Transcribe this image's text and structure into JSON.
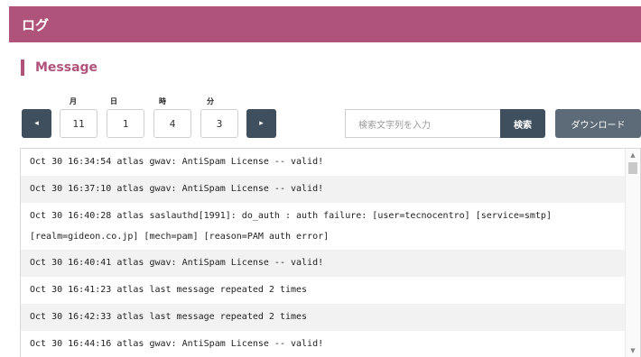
{
  "header": {
    "title": "ログ"
  },
  "section": {
    "title": "Message"
  },
  "date_labels": {
    "month": "月",
    "day": "日",
    "hour": "時",
    "minute": "分"
  },
  "date_values": {
    "month": "11",
    "day": "1",
    "hour": "4",
    "minute": "3"
  },
  "nav": {
    "prev_icon": "chevron-left-icon",
    "next_icon": "chevron-right-icon",
    "prev_glyph": "◂",
    "next_glyph": "▸"
  },
  "search": {
    "placeholder": "検索文字列を入力",
    "button_label": "検索"
  },
  "download": {
    "label": "ダウンロード"
  },
  "log_lines": [
    "Oct 30 16:34:54 atlas gwav: AntiSpam License -- valid!",
    "Oct 30 16:37:10 atlas gwav: AntiSpam License -- valid!",
    "Oct 30 16:40:28 atlas saslauthd[1991]: do_auth : auth failure: [user=tecnocentro] [service=smtp]",
    "[realm=gideon.co.jp] [mech=pam] [reason=PAM auth error]",
    "Oct 30 16:40:41 atlas gwav: AntiSpam License -- valid!",
    "Oct 30 16:41:23 atlas last message repeated 2 times",
    "Oct 30 16:42:33 atlas last message repeated 2 times",
    "Oct 30 16:44:16 atlas gwav: AntiSpam License -- valid!"
  ],
  "scrollbar": {
    "up_glyph": "▲",
    "down_glyph": "▼"
  },
  "colors": {
    "accent": "#b0537b",
    "button_dark": "#3f4f5e",
    "button_gray": "#5d6b78"
  }
}
